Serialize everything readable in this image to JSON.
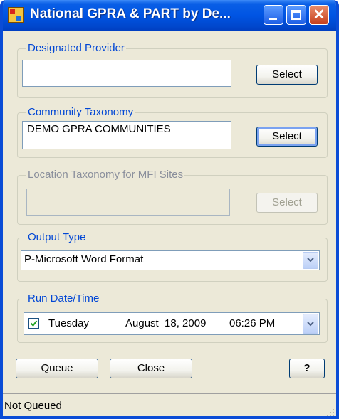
{
  "window": {
    "title": "National GPRA & PART by De..."
  },
  "designated_provider": {
    "label": "Designated Provider",
    "value": "",
    "select_label": "Select"
  },
  "community_taxonomy": {
    "label": "Community Taxonomy",
    "value": "DEMO GPRA COMMUNITIES",
    "select_label": "Select"
  },
  "location_taxonomy": {
    "label": "Location Taxonomy for MFI Sites",
    "value": "",
    "select_label": "Select",
    "enabled": false
  },
  "output_type": {
    "label": "Output Type",
    "selected": "P-Microsoft Word Format"
  },
  "run_datetime": {
    "label": "Run Date/Time",
    "checked": true,
    "weekday": "Tuesday",
    "date": "August  18, 2009",
    "time": "06:26 PM"
  },
  "actions": {
    "queue_label": "Queue",
    "close_label": "Close",
    "help_label": "?"
  },
  "status": {
    "text": "Not Queued"
  },
  "icons": {
    "app": "app-icon",
    "minimize": "minimize-icon",
    "maximize": "maximize-icon",
    "close": "close-icon",
    "dropdown": "chevron-down-icon",
    "check": "check-icon",
    "grip": "resize-grip-icon"
  },
  "colors": {
    "titlebar": "#0054e3",
    "group_label": "#0046d5",
    "window_bg": "#ece9d8"
  }
}
